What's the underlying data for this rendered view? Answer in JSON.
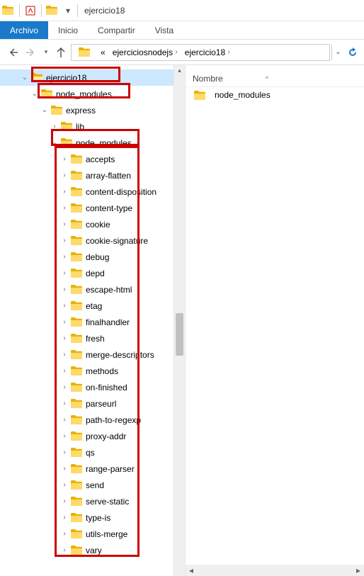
{
  "title": "ejercicio18",
  "ribbon": {
    "file": "Archivo",
    "home": "Inicio",
    "share": "Compartir",
    "view": "Vista"
  },
  "breadcrumb": {
    "prefix": "«",
    "parts": [
      "ejerciciosnodejs",
      "ejercicio18"
    ]
  },
  "columns": {
    "name": "Nombre"
  },
  "content_items": [
    {
      "label": "node_modules"
    }
  ],
  "tree": {
    "root": {
      "label": "ejercicio18",
      "expanded": true
    },
    "lvl1": {
      "label": "node_modules",
      "expanded": true
    },
    "lvl2": {
      "label": "express",
      "expanded": true
    },
    "lvl3a": {
      "label": "lib",
      "expanded": false
    },
    "lvl3b": {
      "label": "node_modules",
      "expanded": true
    },
    "packages": [
      "accepts",
      "array-flatten",
      "content-disposition",
      "content-type",
      "cookie",
      "cookie-signature",
      "debug",
      "depd",
      "escape-html",
      "etag",
      "finalhandler",
      "fresh",
      "merge-descriptors",
      "methods",
      "on-finished",
      "parseurl",
      "path-to-regexp",
      "proxy-addr",
      "qs",
      "range-parser",
      "send",
      "serve-static",
      "type-is",
      "utils-merge",
      "vary"
    ]
  }
}
